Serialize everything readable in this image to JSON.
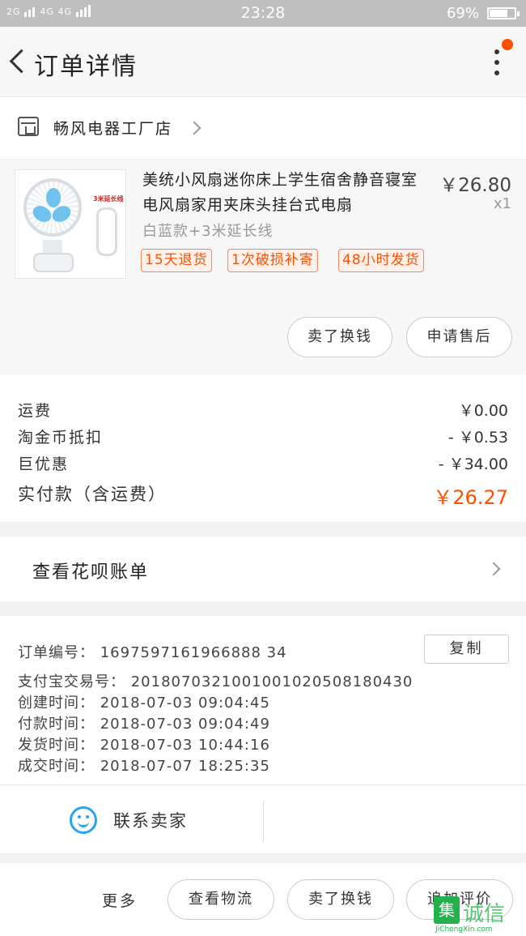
{
  "status_bar": {
    "signal_left": "2G",
    "signal_right": "4G 4G",
    "time": "23:28",
    "battery": "69%"
  },
  "header": {
    "title": "订单详情"
  },
  "shop": {
    "name": "畅风电器工厂店"
  },
  "product": {
    "title": "美统小风扇迷你床上学生宿舍静音寝室电风扇家用夹床头挂台式电扇",
    "image_label": "3米延长线",
    "price": "￥26.80",
    "quantity": "x1",
    "spec": "白蓝款+3米延长线",
    "tags": [
      "15天退货",
      "1次破损补寄",
      "48小时发货"
    ],
    "buttons": {
      "resell": "卖了换钱",
      "after_sales": "申请售后"
    }
  },
  "fees": {
    "shipping": {
      "label": "运费",
      "value": "￥0.00"
    },
    "coin": {
      "label": "淘金币抵扣",
      "value": "- ￥0.53"
    },
    "discount": {
      "label": "巨优惠",
      "value": "- ￥34.00"
    },
    "total": {
      "label": "实付款（含运费）",
      "value": "￥26.27"
    }
  },
  "huabei": {
    "label": "查看花呗账单"
  },
  "order_info": {
    "order_no": "订单编号：  1697597161966888 34",
    "alipay_no": "支付宝交易号：  2018070321001001020508180430",
    "created": "创建时间：  2018-07-03 09:04:45",
    "paid": "付款时间：  2018-07-03 09:04:49",
    "shipped": "发货时间：  2018-07-03 10:44:16",
    "completed": "成交时间：  2018-07-07 18:25:35",
    "copy_label": "复制"
  },
  "contact": {
    "label": "联系卖家"
  },
  "footer": {
    "more": "更多",
    "logistics": "查看物流",
    "resell": "卖了换钱",
    "review": "追加评价"
  },
  "watermark": {
    "box": "集",
    "cn": "诚信",
    "en": "JiChengXin.com"
  },
  "colors": {
    "accent": "#ff5000",
    "contact_blue": "#2ba2f0",
    "status_bar": "#bfbfbf"
  }
}
